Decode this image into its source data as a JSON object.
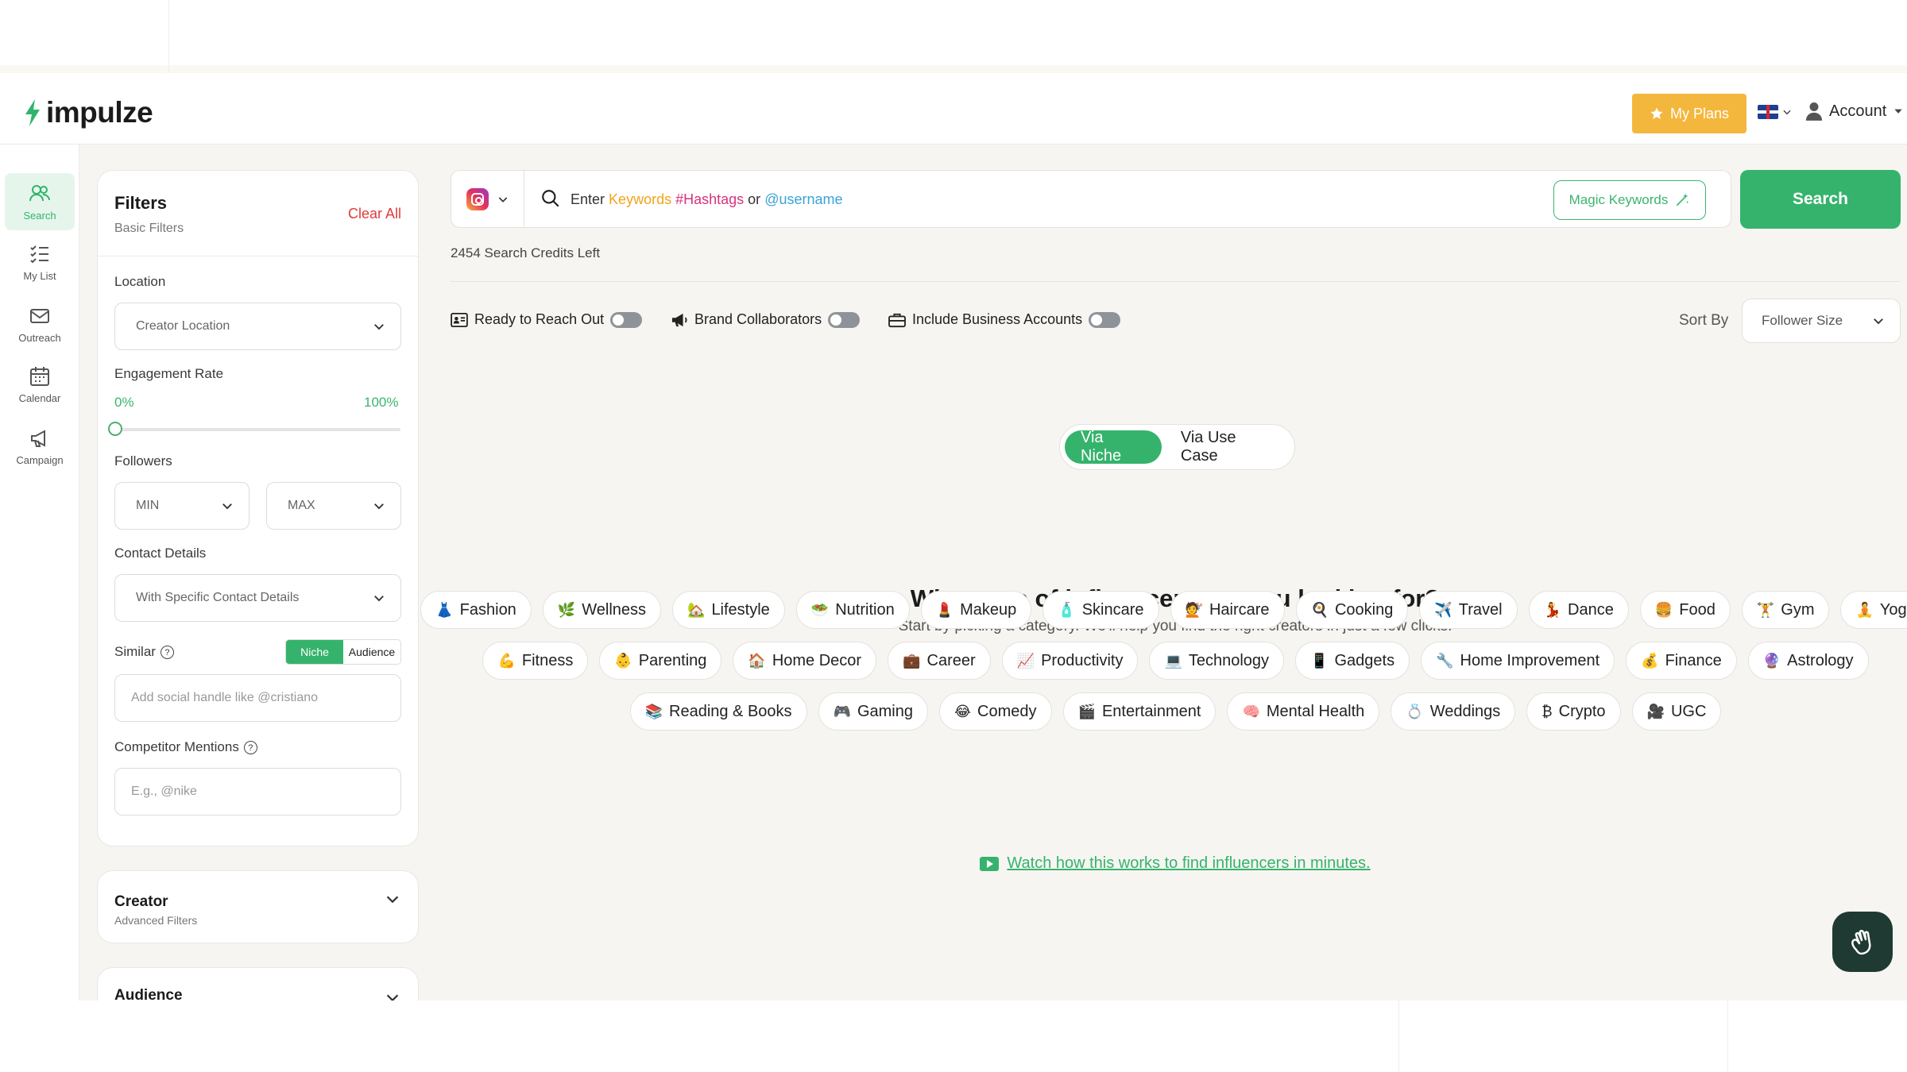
{
  "header": {
    "logo_text": "impulze",
    "my_plans_label": "My Plans",
    "account_label": "Account"
  },
  "nav": {
    "items": [
      {
        "label": "Search",
        "icon": "users-icon",
        "active": true
      },
      {
        "label": "My List",
        "icon": "checklist-icon",
        "active": false
      },
      {
        "label": "Outreach",
        "icon": "mail-icon",
        "active": false
      },
      {
        "label": "Calendar",
        "icon": "calendar-icon",
        "active": false
      },
      {
        "label": "Campaign",
        "icon": "megaphone-icon",
        "active": false
      }
    ]
  },
  "filters": {
    "title": "Filters",
    "subtitle": "Basic Filters",
    "clear_all": "Clear All",
    "location_label": "Location",
    "location_placeholder": "Creator Location",
    "engagement_label": "Engagement Rate",
    "engagement_min": "0%",
    "engagement_max": "100%",
    "engagement_value": 0,
    "followers_label": "Followers",
    "followers_min": "MIN",
    "followers_max": "MAX",
    "contact_label": "Contact Details",
    "contact_value": "With Specific Contact Details",
    "similar_label": "Similar",
    "similar_niche": "Niche",
    "similar_audience": "Audience",
    "similar_placeholder": "Add social handle like @cristiano",
    "competitor_label": "Competitor Mentions",
    "competitor_placeholder": "E.g., @nike"
  },
  "creator_card": {
    "title": "Creator",
    "subtitle": "Advanced Filters"
  },
  "audience_card": {
    "title": "Audience"
  },
  "search": {
    "query_prefix": "Enter",
    "query_keywords": "Keywords",
    "query_hashtags": "#Hashtags",
    "query_or": "or",
    "query_username": "@username",
    "magic_label": "Magic Keywords",
    "button_label": "Search",
    "credits": "2454 Search Credits Left"
  },
  "toggles": {
    "ready": "Ready to Reach Out",
    "brand": "Brand Collaborators",
    "business": "Include Business Accounts"
  },
  "sort": {
    "label": "Sort By",
    "value": "Follower Size"
  },
  "via": {
    "niche": "Via Niche",
    "use_case": "Via Use Case"
  },
  "prompt": {
    "title": "What type of influencers are you looking for?",
    "subtitle": "Start by picking a category. We'll help you find the right creators in just a few clicks."
  },
  "categories": {
    "row1": [
      {
        "emoji": "👗",
        "label": "Fashion"
      },
      {
        "emoji": "🌿",
        "label": "Wellness"
      },
      {
        "emoji": "🏡",
        "label": "Lifestyle"
      },
      {
        "emoji": "🥗",
        "label": "Nutrition"
      },
      {
        "emoji": "💄",
        "label": "Makeup"
      },
      {
        "emoji": "🧴",
        "label": "Skincare"
      },
      {
        "emoji": "💇",
        "label": "Haircare"
      },
      {
        "emoji": "🍳",
        "label": "Cooking"
      },
      {
        "emoji": "✈️",
        "label": "Travel"
      },
      {
        "emoji": "💃",
        "label": "Dance"
      },
      {
        "emoji": "🍔",
        "label": "Food"
      },
      {
        "emoji": "🏋️",
        "label": "Gym"
      },
      {
        "emoji": "🧘",
        "label": "Yoga"
      }
    ],
    "row2": [
      {
        "emoji": "💪",
        "label": "Fitness"
      },
      {
        "emoji": "👶",
        "label": "Parenting"
      },
      {
        "emoji": "🏠",
        "label": "Home Decor"
      },
      {
        "emoji": "💼",
        "label": "Career"
      },
      {
        "emoji": "📈",
        "label": "Productivity"
      },
      {
        "emoji": "💻",
        "label": "Technology"
      },
      {
        "emoji": "📱",
        "label": "Gadgets"
      },
      {
        "emoji": "🔧",
        "label": "Home Improvement"
      },
      {
        "emoji": "💰",
        "label": "Finance"
      },
      {
        "emoji": "🔮",
        "label": "Astrology"
      }
    ],
    "row3": [
      {
        "emoji": "📚",
        "label": "Reading & Books"
      },
      {
        "emoji": "🎮",
        "label": "Gaming"
      },
      {
        "emoji": "😂",
        "label": "Comedy"
      },
      {
        "emoji": "🎬",
        "label": "Entertainment"
      },
      {
        "emoji": "🧠",
        "label": "Mental Health"
      },
      {
        "emoji": "💍",
        "label": "Weddings"
      },
      {
        "emoji": "₿",
        "label": "Crypto"
      },
      {
        "emoji": "🎥",
        "label": "UGC"
      }
    ]
  },
  "watch_link": "Watch how this works to find influencers in minutes.",
  "colors": {
    "accent": "#35b36c",
    "plans": "#f4b73d",
    "danger": "#e23b3b"
  }
}
